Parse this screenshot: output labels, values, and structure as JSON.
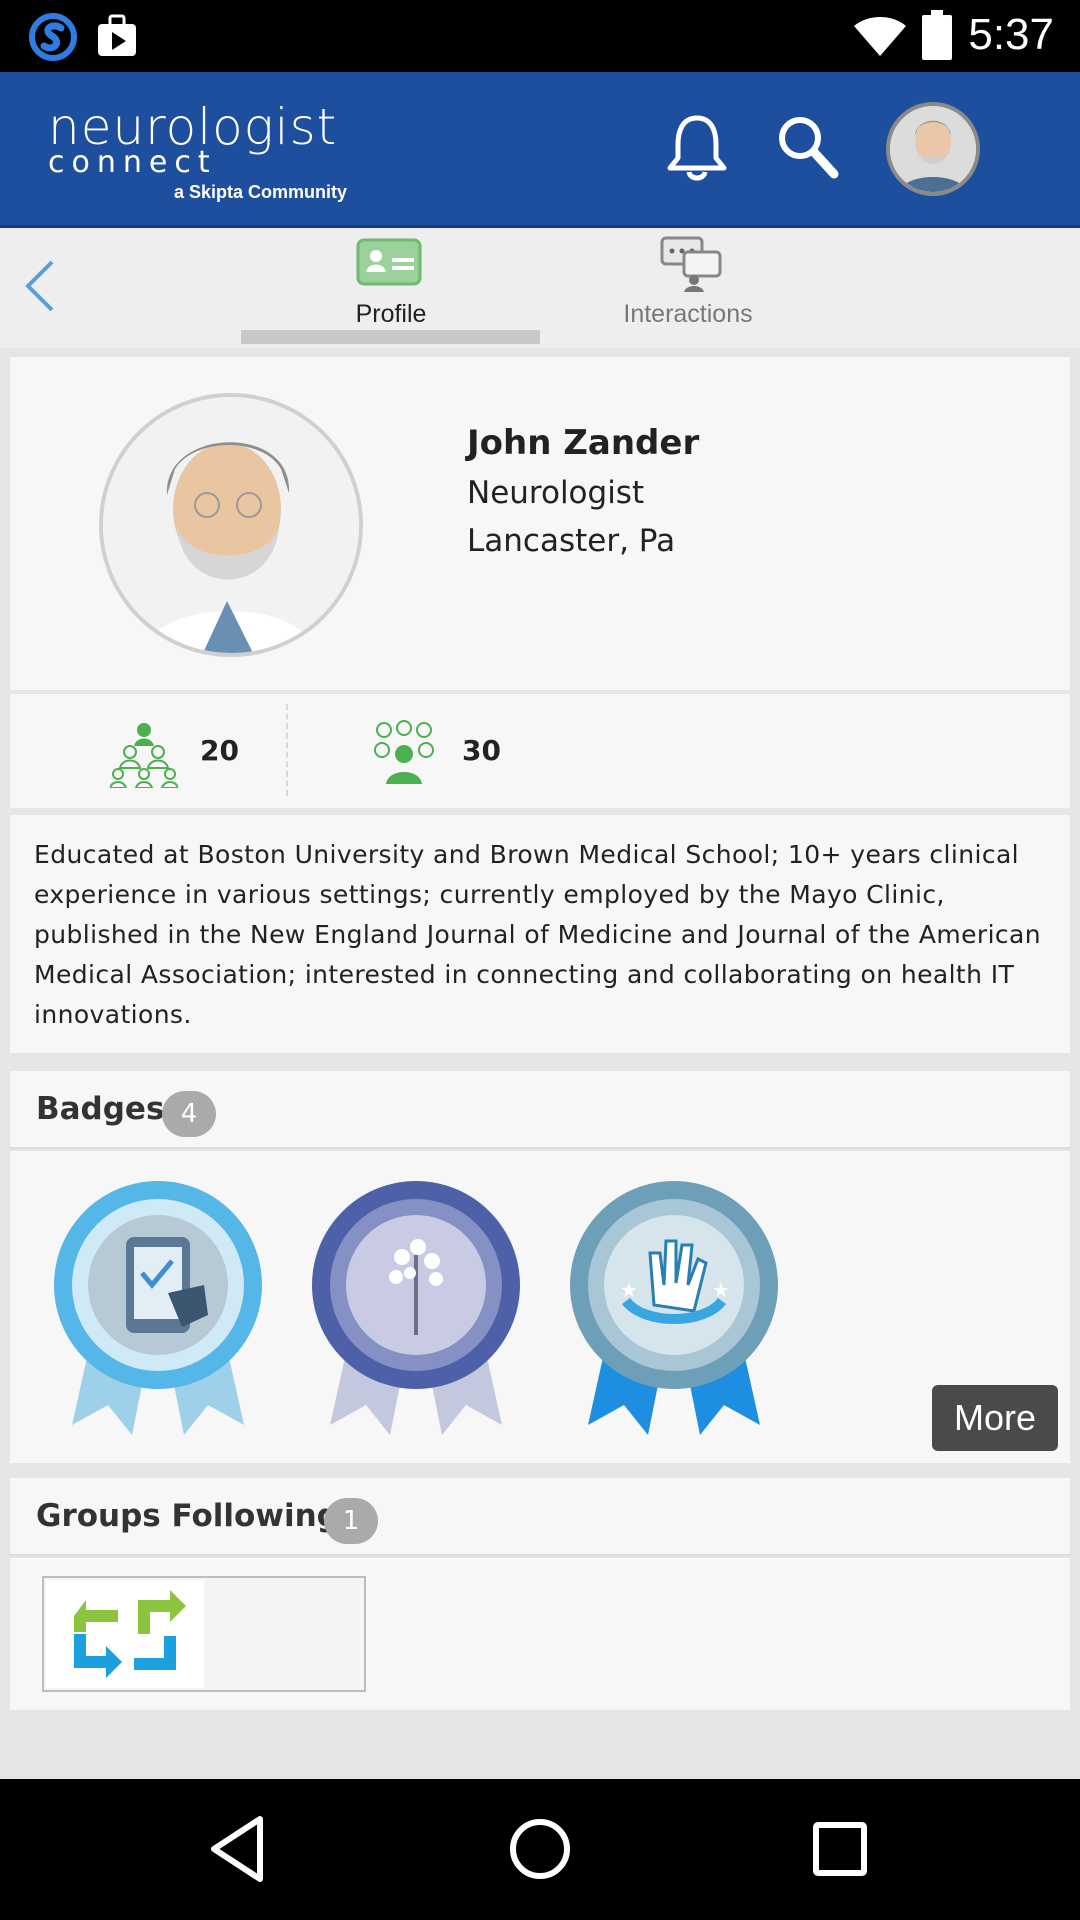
{
  "status_bar": {
    "time": "5:37",
    "icons": [
      "skype-icon",
      "media-upload-icon",
      "wifi-icon",
      "battery-icon"
    ]
  },
  "header": {
    "logo_line1": "neurologist",
    "logo_line2": "connect",
    "logo_line3": "a Skipta Community",
    "icons": [
      "bell-icon",
      "search-icon",
      "avatar"
    ],
    "brand_color": "#1d4f9e"
  },
  "tabs": [
    {
      "label": "Profile",
      "icon": "profile-card-icon",
      "active": true
    },
    {
      "label": "Interactions",
      "icon": "chat-bubbles-icon",
      "active": false
    }
  ],
  "profile": {
    "name": "John Zander",
    "specialty": "Neurologist",
    "location": "Lancaster, Pa"
  },
  "stats": [
    {
      "icon": "followers-icon",
      "count": "20"
    },
    {
      "icon": "following-icon",
      "count": "30"
    }
  ],
  "bio": "Educated at Boston University and Brown Medical School; 10+ years clinical experience in various settings; currently employed by the Mayo Clinic, published in the New England Journal of Medicine and Journal of the American Medical Association; interested in connecting and collaborating on health IT innovations.",
  "badges": {
    "title": "Badges",
    "count": "4",
    "items": [
      "tablet-touch-badge",
      "tree-badge",
      "hand-badge"
    ],
    "more_label": "More"
  },
  "groups": {
    "title": "Groups Following",
    "count": "1",
    "items": [
      "exchange-arrows-logo"
    ]
  },
  "nav": [
    "back-icon",
    "home-icon",
    "recents-icon"
  ]
}
